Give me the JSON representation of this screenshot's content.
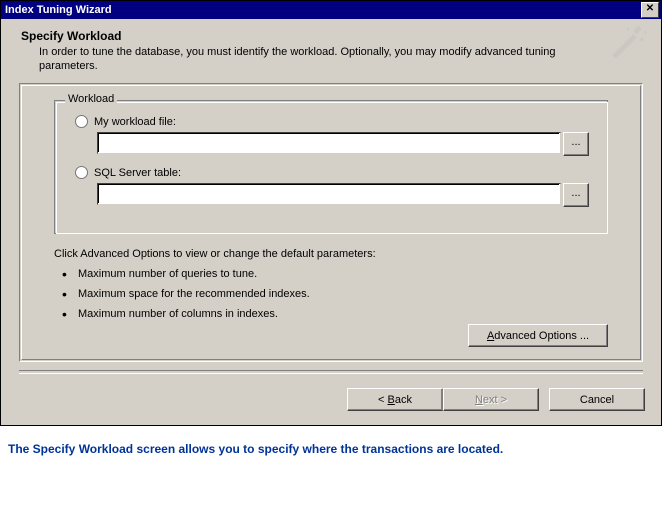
{
  "window": {
    "title": "Index Tuning Wizard"
  },
  "header": {
    "title": "Specify Workload",
    "description": "In order to tune the database, you must identify the workload. Optionally, you may modify advanced tuning parameters."
  },
  "workload": {
    "group_label": "Workload",
    "option_file_label": "My workload file:",
    "option_table_label": "SQL Server table:",
    "file_value": "",
    "table_value": "",
    "browse_label": "..."
  },
  "advanced": {
    "intro": "Click Advanced Options to view or change the default parameters:",
    "bullets": [
      "Maximum number of queries to tune.",
      "Maximum space for the recommended indexes.",
      "Maximum number of columns in indexes."
    ],
    "button_prefix": "A",
    "button_rest": "dvanced Options ..."
  },
  "nav": {
    "back_prefix": "< ",
    "back_ul": "B",
    "back_rest": "ack",
    "next_ul": "N",
    "next_rest": "ext >",
    "cancel": "Cancel"
  },
  "caption": "The Specify Workload screen allows you to specify where the transactions are located."
}
